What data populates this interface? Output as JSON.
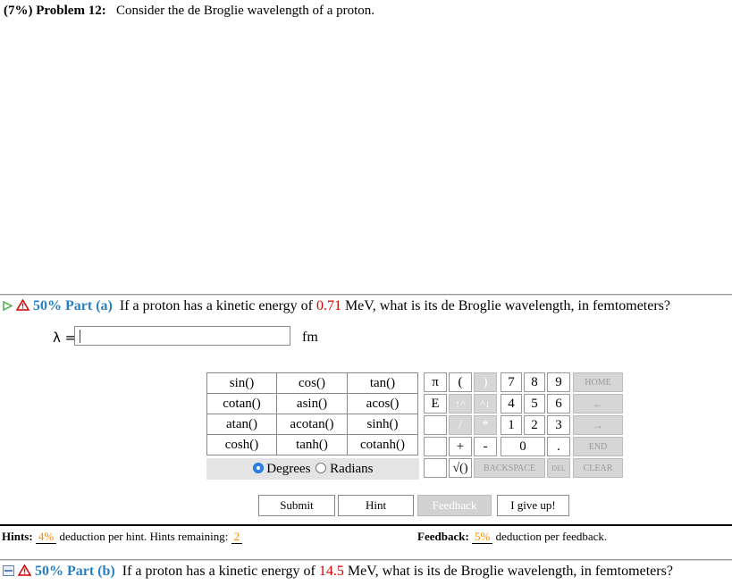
{
  "problem": {
    "number_label": "(7%) Problem 12:",
    "statement": "Consider the de Broglie wavelength of a proton."
  },
  "part_a": {
    "label": "50% Part (a)",
    "text_before": "If a proton has a kinetic energy of",
    "value": "0.71",
    "text_after": "MeV, what is its de Broglie wavelength, in femtometers?",
    "input_symbol": "λ =",
    "input_value": "",
    "unit": "fm"
  },
  "calculator": {
    "functions": [
      [
        "sin()",
        "cos()",
        "tan()"
      ],
      [
        "cotan()",
        "asin()",
        "acos()"
      ],
      [
        "atan()",
        "acotan()",
        "sinh()"
      ],
      [
        "cosh()",
        "tanh()",
        "cotanh()"
      ]
    ],
    "angle_modes": {
      "degrees": "Degrees",
      "radians": "Radians",
      "selected": "Degrees"
    },
    "keys": {
      "pi": "π",
      "open_paren": "(",
      "close_paren": ")",
      "e": "E",
      "up_caret": "↑^",
      "caret_down": "^↓",
      "slash": "/",
      "star": "*",
      "plus": "+",
      "minus": "-",
      "sqrt": "√()",
      "d7": "7",
      "d8": "8",
      "d9": "9",
      "d4": "4",
      "d5": "5",
      "d6": "6",
      "d1": "1",
      "d2": "2",
      "d3": "3",
      "d0": "0",
      "dot": ".",
      "home": "HOME",
      "left": "←",
      "right": "→",
      "end": "END",
      "backspace": "BACKSPACE",
      "del": "DEL",
      "clear": "CLEAR"
    }
  },
  "buttons": {
    "submit": "Submit",
    "hint": "Hint",
    "feedback": "Feedback",
    "give_up": "I give up!"
  },
  "hints": {
    "label": "Hints:",
    "deduction": "4%",
    "text": "deduction per hint. Hints remaining:",
    "remaining": "2"
  },
  "feedback": {
    "label": "Feedback:",
    "deduction": "5%",
    "text": "deduction per feedback."
  },
  "part_b": {
    "label": "50% Part (b)",
    "text_before": "If a proton has a kinetic energy of",
    "value": "14.5",
    "text_after": "MeV, what is its de Broglie wavelength, in femtometers?"
  },
  "colors": {
    "part_label": "#2a7fc1",
    "value_highlight": "#d40000",
    "deduction_highlight": "#ff8c00",
    "radio_selected": "#2f7fe8"
  }
}
